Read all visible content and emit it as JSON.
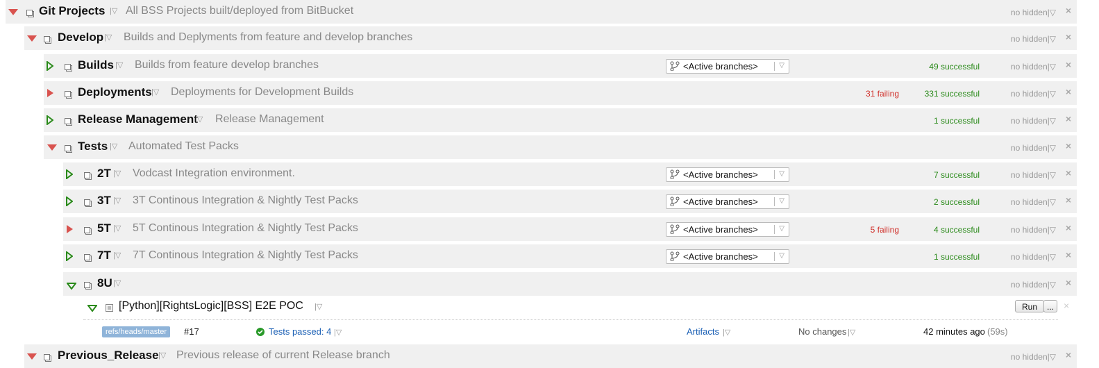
{
  "projects": [
    {
      "name": "Git Projects",
      "desc": "All BSS Projects built/deployed from BitBucket",
      "hidden": "no hidden",
      "icon": "collapse-triangle-red"
    },
    {
      "name": "Develop",
      "desc": "Builds and Deplyments from feature and develop branches",
      "hidden": "no hidden",
      "icon": "collapse-triangle-red"
    },
    {
      "name": "Builds",
      "desc": "Builds from feature develop branches",
      "hidden": "no hidden",
      "branch": "<Active branches>",
      "ok": "49 successful",
      "icon": "expand-triangle-green"
    },
    {
      "name": "Deployments",
      "desc": "Deployments for Development Builds",
      "hidden": "no hidden",
      "fail": "31 failing",
      "ok": "331 successful",
      "icon": "expand-triangle-red"
    },
    {
      "name": "Release Management",
      "desc": "Release Management",
      "hidden": "no hidden",
      "ok": "1 successful",
      "icon": "expand-triangle-green"
    },
    {
      "name": "Tests",
      "desc": "Automated Test Packs",
      "hidden": "no hidden",
      "icon": "collapse-triangle-red"
    },
    {
      "name": "2T",
      "desc": "Vodcast Integration environment.",
      "hidden": "no hidden",
      "branch": "<Active branches>",
      "ok": "7 successful",
      "icon": "expand-triangle-green"
    },
    {
      "name": "3T",
      "desc": "3T Continous Integration & Nightly Test Packs",
      "hidden": "no hidden",
      "branch": "<Active branches>",
      "ok": "2 successful",
      "icon": "expand-triangle-green"
    },
    {
      "name": "5T",
      "desc": "5T Continous Integration & Nightly Test Packs",
      "hidden": "no hidden",
      "branch": "<Active branches>",
      "fail": "5 failing",
      "ok": "4 successful",
      "icon": "expand-triangle-red"
    },
    {
      "name": "7T",
      "desc": "7T Continous Integration & Nightly Test Packs",
      "hidden": "no hidden",
      "branch": "<Active branches>",
      "ok": "1 successful",
      "icon": "expand-triangle-green"
    },
    {
      "name": "8U",
      "desc": "",
      "hidden": "no hidden",
      "icon": "collapse-triangle-green"
    }
  ],
  "build_config": {
    "name": "[Python][RightsLogic][BSS] E2E POC",
    "run_label": "Run",
    "more_label": "...",
    "close": "×"
  },
  "build": {
    "branch": "refs/heads/master",
    "number": "#17",
    "status": "Tests passed: 4",
    "artifacts": "Artifacts",
    "changes": "No changes",
    "time": "42 minutes ago",
    "duration": "(59s)"
  },
  "previous": {
    "name": "Previous_Release",
    "desc": "Previous release of current Release branch",
    "hidden": "no hidden"
  },
  "ui": {
    "close": "×",
    "caret": "|▽"
  },
  "colors": {
    "success": "#2a8a1a",
    "failing": "#d0302a",
    "badge": "#8fb4d9",
    "link": "#1a5fb4"
  }
}
